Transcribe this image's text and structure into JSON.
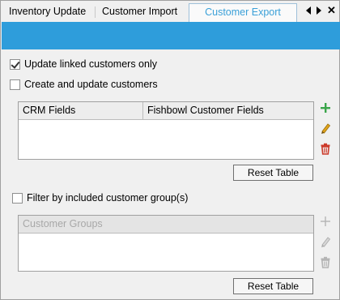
{
  "tabs": {
    "items": [
      {
        "label": "Inventory Update"
      },
      {
        "label": "Customer Import"
      },
      {
        "label": "Customer Export"
      }
    ],
    "active_index": 2
  },
  "options": {
    "update_linked_label": "Update linked customers only",
    "update_linked_checked": true,
    "create_update_label": "Create and update customers",
    "create_update_checked": false
  },
  "fields_table": {
    "columns": [
      "CRM Fields",
      "Fishbowl Customer Fields"
    ],
    "rows": [],
    "reset_label": "Reset Table"
  },
  "filter": {
    "label": "Filter by included customer group(s)",
    "checked": false
  },
  "groups_table": {
    "columns": [
      "Customer Groups"
    ],
    "rows": [],
    "enabled": false,
    "reset_label": "Reset Table"
  },
  "colors": {
    "accent_bar": "#2e9ddb",
    "active_tab_text": "#3aa0d8",
    "add_icon": "#3aa54a",
    "edit_icon": "#e0a41c",
    "delete_icon": "#cc3b2b",
    "disabled_icon": "#b4b4b4"
  },
  "icons": {
    "scroll_left": "arrow-left-icon",
    "scroll_right": "arrow-right-icon",
    "close": "close-icon",
    "add": "plus-icon",
    "edit": "pencil-icon",
    "delete": "trash-icon"
  }
}
